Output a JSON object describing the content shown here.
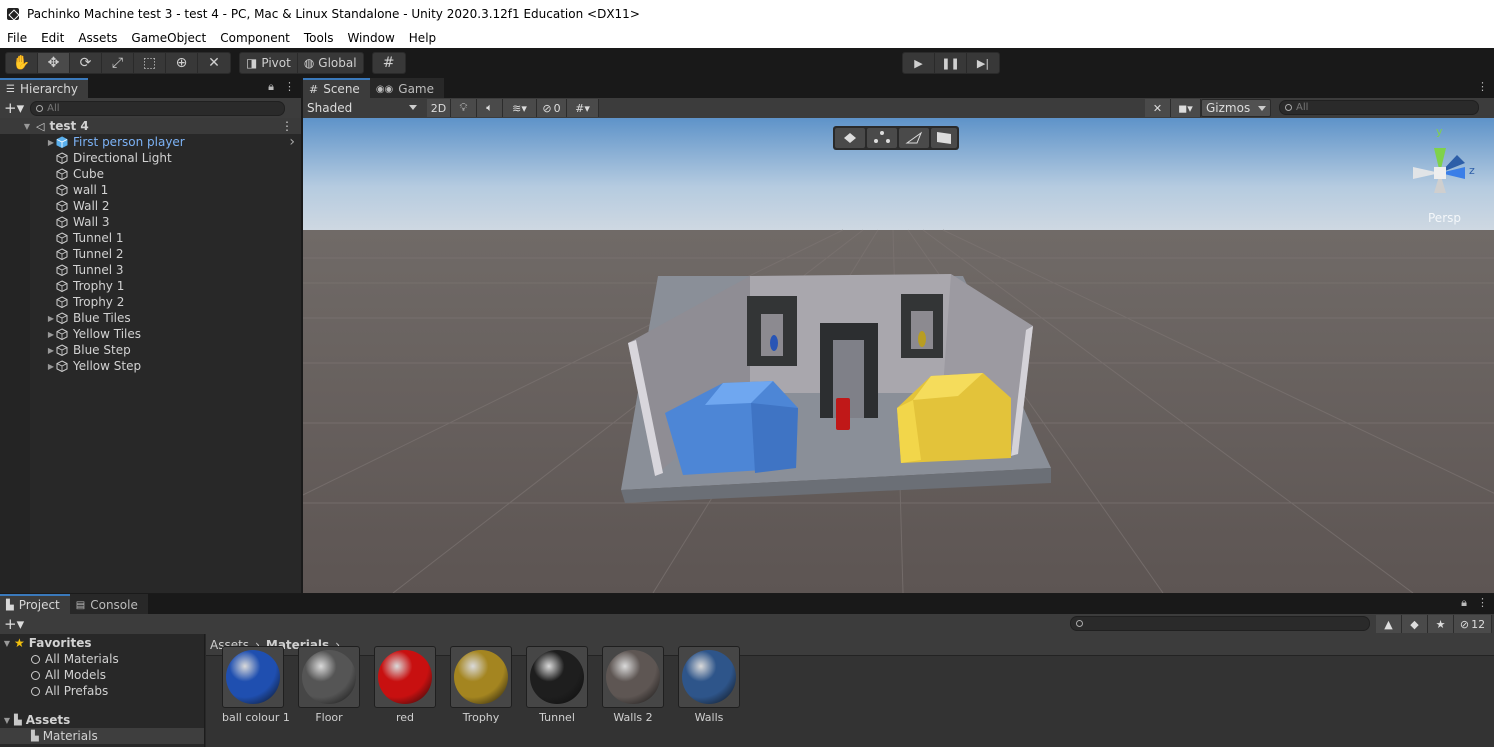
{
  "window": {
    "title": "Pachinko Machine test 3 - test 4 - PC, Mac & Linux Standalone - Unity 2020.3.12f1 Education <DX11>"
  },
  "menu": [
    "File",
    "Edit",
    "Assets",
    "GameObject",
    "Component",
    "Tools",
    "Window",
    "Help"
  ],
  "toolbar": {
    "tools": [
      "hand-tool-icon",
      "move-tool-icon",
      "rotate-tool-icon",
      "scale-tool-icon",
      "rect-tool-icon",
      "transform-tool-icon",
      "custom-tool-icon"
    ],
    "active_tool": "move-tool-icon",
    "pivot_label": "Pivot",
    "global_label": "Global",
    "grid_snap": "grid-snap-icon",
    "playback": [
      "play-icon",
      "pause-icon",
      "step-icon"
    ]
  },
  "hierarchy": {
    "tab_label": "Hierarchy",
    "search_placeholder": "All",
    "scene_name": "test 4",
    "items": [
      {
        "label": "First person player",
        "expandable": true,
        "selected_color": "#7cb2f5",
        "prefab": true
      },
      {
        "label": "Directional Light",
        "expandable": false
      },
      {
        "label": "Cube",
        "expandable": false
      },
      {
        "label": "wall 1",
        "expandable": false
      },
      {
        "label": "Wall 2",
        "expandable": false
      },
      {
        "label": "Wall 3",
        "expandable": false
      },
      {
        "label": "Tunnel 1",
        "expandable": false
      },
      {
        "label": "Tunnel 2",
        "expandable": false
      },
      {
        "label": "Tunnel 3",
        "expandable": false
      },
      {
        "label": "Trophy 1",
        "expandable": false
      },
      {
        "label": "Trophy 2",
        "expandable": false
      },
      {
        "label": "Blue Tiles",
        "expandable": true
      },
      {
        "label": "Yellow Tiles",
        "expandable": true
      },
      {
        "label": "Blue Step",
        "expandable": true
      },
      {
        "label": "Yellow Step",
        "expandable": true
      }
    ]
  },
  "scene": {
    "tabs": [
      {
        "label": "Scene",
        "icon": "scene-hash-icon"
      },
      {
        "label": "Game",
        "icon": "game-controller-icon"
      }
    ],
    "shading_mode": "Shaded",
    "toggle_2d": "2D",
    "hidden_count": "0",
    "gizmos_label": "Gizmos",
    "search_placeholder": "All",
    "persp_label": "Persp",
    "axis_labels": {
      "y": "y",
      "z": "z"
    }
  },
  "project": {
    "tabs": [
      {
        "label": "Project"
      },
      {
        "label": "Console"
      }
    ],
    "favorites_label": "Favorites",
    "favorites": [
      "All Materials",
      "All Models",
      "All Prefabs"
    ],
    "assets_label": "Assets",
    "assets_children": [
      "Materials"
    ],
    "breadcrumb": [
      "Assets",
      "Materials"
    ],
    "hidden_packages": "12",
    "materials": [
      {
        "name": "ball colour 1",
        "color": "#1f4fb0"
      },
      {
        "name": "Floor",
        "color": "#555555"
      },
      {
        "name": "red",
        "color": "#c81010"
      },
      {
        "name": "Trophy",
        "color": "#a48520"
      },
      {
        "name": "Tunnel",
        "color": "#1e1e1e"
      },
      {
        "name": "Walls 2",
        "color": "#5e5653"
      },
      {
        "name": "Walls",
        "color": "#2e558a"
      }
    ]
  },
  "colors": {
    "accent_tab": "#3a79bb",
    "selected_text": "#7cb2f5",
    "panel_bg": "#282828",
    "toolbar_bg": "#3c3c3c"
  }
}
